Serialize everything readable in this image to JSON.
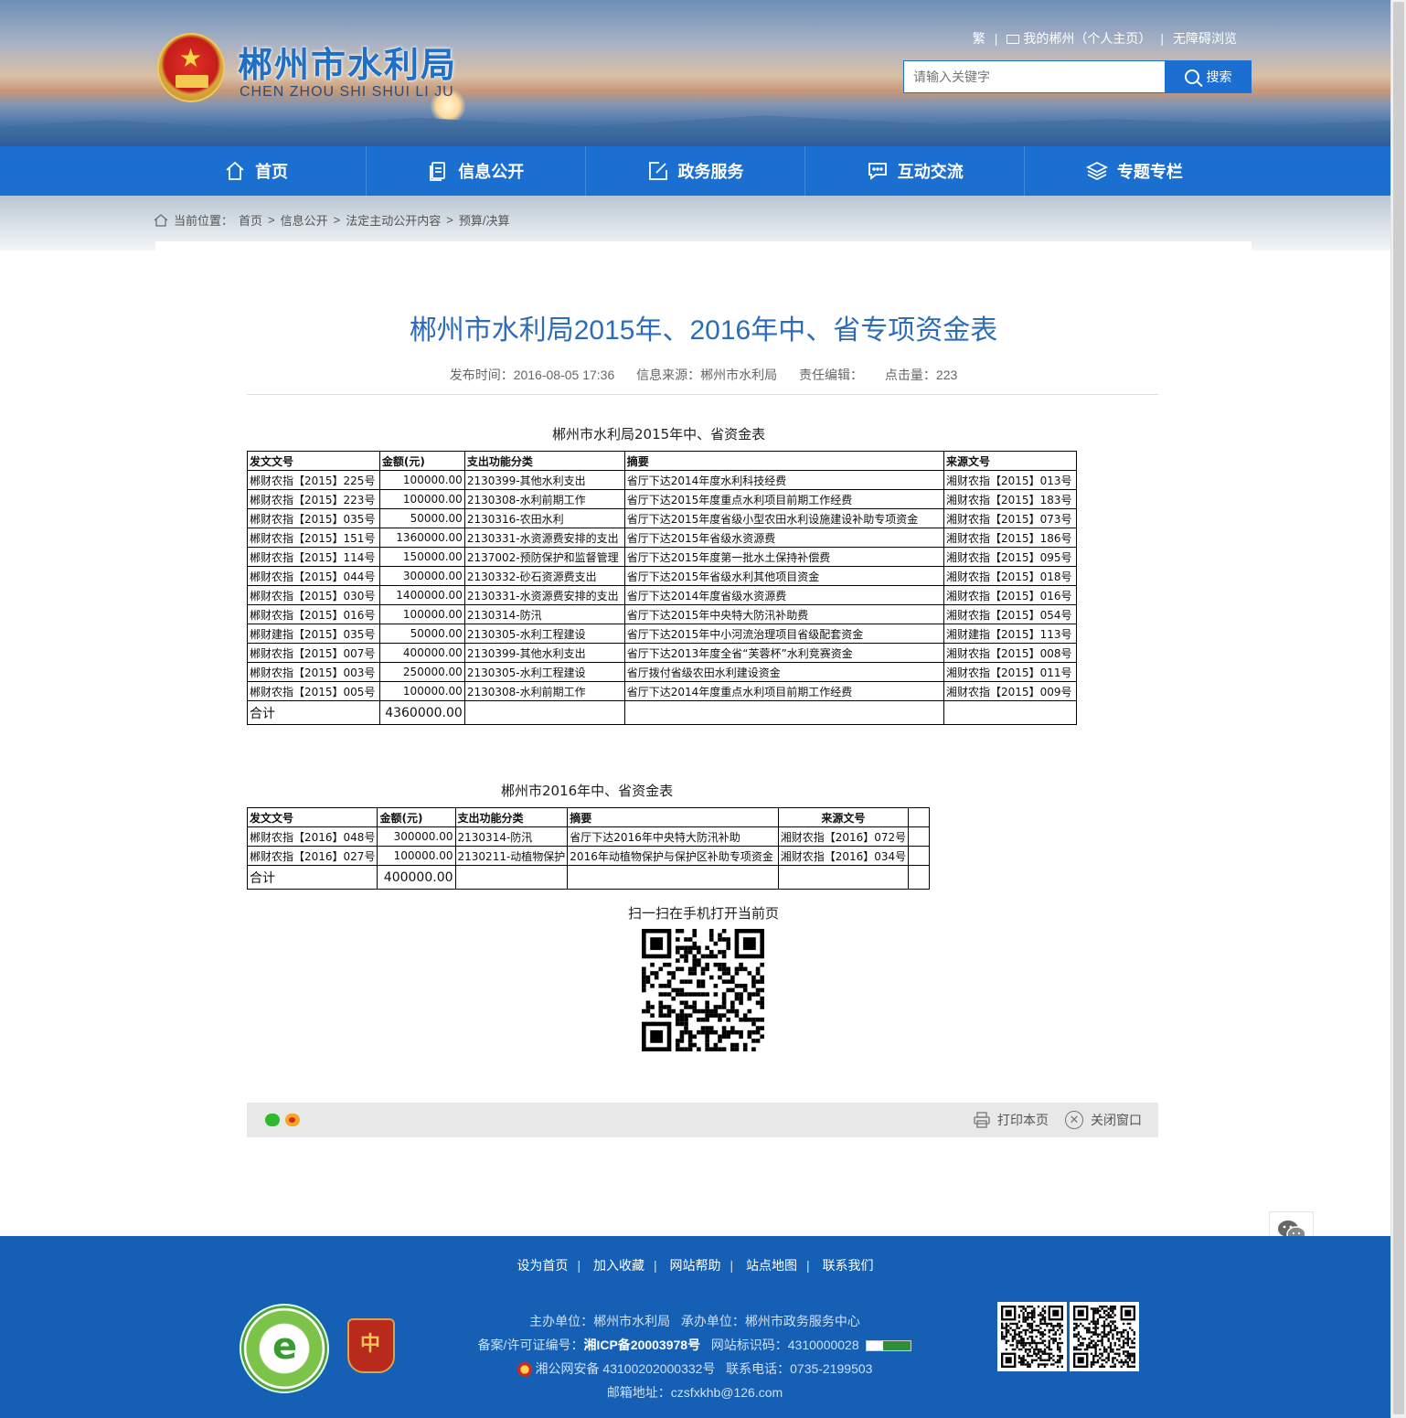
{
  "header": {
    "title": "郴州市水利局",
    "subtitle": "CHEN ZHOU SHI SHUI LI JU",
    "links": {
      "traditional": "繁",
      "my_site": "我的郴州（个人主页）",
      "accessibility": "无障碍浏览"
    },
    "search": {
      "placeholder": "请输入关键字",
      "button": "搜索"
    }
  },
  "nav": [
    "首页",
    "信息公开",
    "政务服务",
    "互动交流",
    "专题专栏"
  ],
  "breadcrumb": {
    "prefix": "当前位置：",
    "items": [
      "首页",
      "信息公开",
      "法定主动公开内容",
      "预算/决算"
    ]
  },
  "article": {
    "title": "郴州市水利局2015年、2016年中、省专项资金表",
    "publish_time": "发布时间：2016-08-05 17:36",
    "source": "信息来源：郴州市水利局",
    "editor": "责任编辑：",
    "hits": "点击量：223"
  },
  "table2015": {
    "caption": "郴州市水利局2015年中、省资金表",
    "headers": [
      "发文文号",
      "金额(元)",
      "支出功能分类",
      "摘要",
      "来源文号"
    ],
    "rows": [
      [
        "郴财农指【2015】225号",
        "100000.00",
        "2130399-其他水利支出",
        "省厅下达2014年度水利科技经费",
        "湘财农指【2015】013号"
      ],
      [
        "郴财农指【2015】223号",
        "100000.00",
        "2130308-水利前期工作",
        "省厅下达2015年度重点水利项目前期工作经费",
        "湘财农指【2015】183号"
      ],
      [
        "郴财农指【2015】035号",
        "50000.00",
        "2130316-农田水利",
        "省厅下达2015年度省级小型农田水利设施建设补助专项资金",
        "湘财农指【2015】073号"
      ],
      [
        "郴财农指【2015】151号",
        "1360000.00",
        "2130331-水资源费安排的支出",
        "省厅下达2015年省级水资源费",
        "湘财农指【2015】186号"
      ],
      [
        "郴财农指【2015】114号",
        "150000.00",
        "2137002-预防保护和监督管理",
        "省厅下达2015年度第一批水土保持补偿费",
        "湘财农指【2015】095号"
      ],
      [
        "郴财农指【2015】044号",
        "300000.00",
        "2130332-砂石资源费支出",
        "省厅下达2015年省级水利其他项目资金",
        "湘财农指【2015】018号"
      ],
      [
        "郴财农指【2015】030号",
        "1400000.00",
        "2130331-水资源费安排的支出",
        "省厅下达2014年度省级水资源费",
        "湘财农指【2015】016号"
      ],
      [
        "郴财农指【2015】016号",
        "100000.00",
        "2130314-防汛",
        "省厅下达2015年中央特大防汛补助费",
        "湘财农指【2015】054号"
      ],
      [
        "郴财建指【2015】035号",
        "50000.00",
        "2130305-水利工程建设",
        "省厅下达2015年中小河流治理项目省级配套资金",
        "湘财建指【2015】113号"
      ],
      [
        "郴财农指【2015】007号",
        "400000.00",
        "2130399-其他水利支出",
        "省厅下达2013年度全省“芙蓉杯”水利竞赛资金",
        "湘财农指【2015】008号"
      ],
      [
        "郴财农指【2015】003号",
        "250000.00",
        "2130305-水利工程建设",
        "省厅拨付省级农田水利建设资金",
        "湘财农指【2015】011号"
      ],
      [
        "郴财农指【2015】005号",
        "100000.00",
        "2130308-水利前期工作",
        "省厅下达2014年度重点水利项目前期工作经费",
        "湘财农指【2015】009号"
      ]
    ],
    "total_label": "合计",
    "total": "4360000.00"
  },
  "table2016": {
    "caption": "郴州市2016年中、省资金表",
    "headers": [
      "发文文号",
      "金额(元)",
      "支出功能分类",
      "摘要",
      "来源文号"
    ],
    "rows": [
      [
        "郴财农指【2016】048号",
        "300000.00",
        "2130314-防汛",
        "省厅下达2016年中央特大防汛补助",
        "湘财农指【2016】072号"
      ],
      [
        "郴财农指【2016】027号",
        "100000.00",
        "2130211-动植物保护",
        "2016年动植物保护与保护区补助专项资金",
        "湘财农指【2016】034号"
      ]
    ],
    "total_label": "合计",
    "total": "400000.00"
  },
  "qr_caption": "扫一扫在手机打开当前页",
  "actions": {
    "print": "打印本页",
    "close": "关闭窗口"
  },
  "footer": {
    "links": [
      "设为首页",
      "加入收藏",
      "网站帮助",
      "站点地图",
      "联系我们"
    ],
    "host_label": "主办单位：",
    "host": "郴州市水利局",
    "organizer_label": "承办单位：",
    "organizer": "郴州市政务服务中心",
    "icp_label": "备案/许可证编号：",
    "icp": "湘ICP备20003978号",
    "site_id_label": "网站标识码：",
    "site_id": "4310000028",
    "police": "湘公网安备 43100202000332号",
    "phone": "联系电话：0735-2199503",
    "email": "邮箱地址：czsfxkhb@126.com",
    "badge_civ": "郴州市创建文明网站",
    "badge_party": "党政机关"
  },
  "colors": {
    "primary": "#1a6fd1",
    "footer": "#1560b5",
    "title": "#2d6cb6"
  }
}
